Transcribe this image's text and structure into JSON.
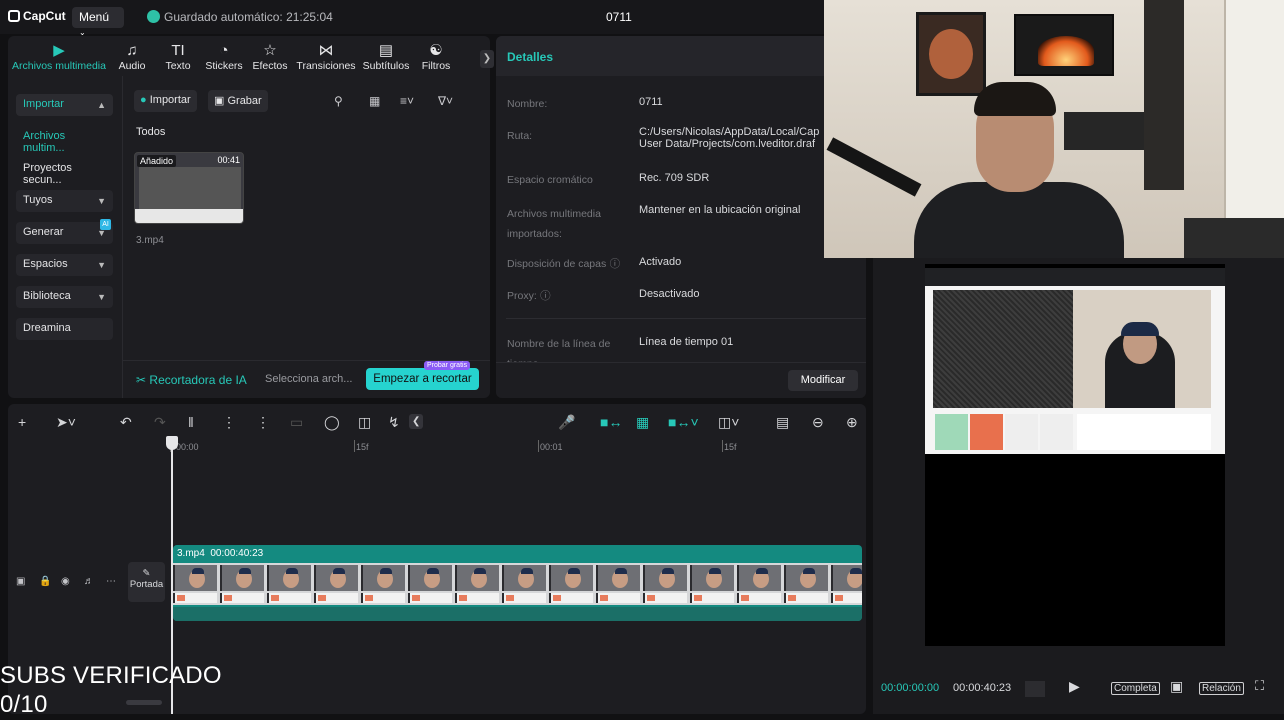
{
  "topbar": {
    "logo": "CapCut",
    "menu_label": "Menú",
    "autosave": "Guardado automático: 21:25:04",
    "project_title": "0711"
  },
  "media_tabs": [
    {
      "label": "Archivos multimedia",
      "icon": "media-play-icon"
    },
    {
      "label": "Audio",
      "icon": "audio-icon"
    },
    {
      "label": "Texto",
      "icon": "text-icon"
    },
    {
      "label": "Stickers",
      "icon": "stickers-icon"
    },
    {
      "label": "Efectos",
      "icon": "effects-icon"
    },
    {
      "label": "Transiciones",
      "icon": "transitions-icon"
    },
    {
      "label": "Subtítulos",
      "icon": "subtitles-icon"
    },
    {
      "label": "Filtros",
      "icon": "filters-icon"
    }
  ],
  "sidebar": [
    {
      "label": "Importar",
      "chevron": "^"
    },
    {
      "label": "Archivos multim..."
    },
    {
      "label": "Proyectos secun..."
    },
    {
      "label": "Tuyos",
      "chevron": "v"
    },
    {
      "label": "Generar",
      "chevron": "v",
      "badge": "AI"
    },
    {
      "label": "Espacios",
      "chevron": "v"
    },
    {
      "label": "Biblioteca",
      "chevron": "v"
    },
    {
      "label": "Dreamina"
    }
  ],
  "media": {
    "import_label": "Importar",
    "record_label": "Grabar",
    "section_label": "Todos",
    "item": {
      "badge": "Añadido",
      "duration": "00:41",
      "filename": "3.mp4"
    },
    "cutter_title": "Recortadora de IA",
    "cutter_select": "Selecciona arch...",
    "cutter_button": "Empezar a recortar",
    "free_tag": "Probar gratis"
  },
  "details": {
    "heading": "Detalles",
    "rows": [
      {
        "label": "Nombre:",
        "value": "0711"
      },
      {
        "label": "Ruta:",
        "value": "C:/Users/Nicolas/AppData/Local/Cap",
        "value2": "User Data/Projects/com.lveditor.draf"
      },
      {
        "label": "Espacio cromático",
        "value": "Rec. 709 SDR"
      },
      {
        "label": "Archivos multimedia",
        "label2": "importados:",
        "value": "Mantener en la ubicación original"
      },
      {
        "label": "Disposición de capas",
        "value": "Activado"
      },
      {
        "label": "Proxy:",
        "value": "Desactivado"
      },
      {
        "label": "Nombre de la línea de",
        "label2": "tiempo",
        "value": "Línea de tiempo 01"
      }
    ],
    "modify_button": "Modificar"
  },
  "timeline": {
    "ticks": [
      "00:00",
      "15f",
      "00:01",
      "15f"
    ],
    "cover_label": "Portada",
    "clip_name": "3.mp4",
    "clip_duration": "00:00:40:23"
  },
  "player": {
    "current_time": "00:00:00:00",
    "total_time": "00:00:40:23",
    "full_label": "Completa",
    "ratio_label": "Relación"
  },
  "overlay": {
    "subs_line1": "SUBS VERIFICADO",
    "subs_line2": "0/10"
  },
  "colors": {
    "accent": "#27c8b8",
    "panel": "#1d1d21",
    "background": "#111113",
    "clip": "#148a80"
  }
}
